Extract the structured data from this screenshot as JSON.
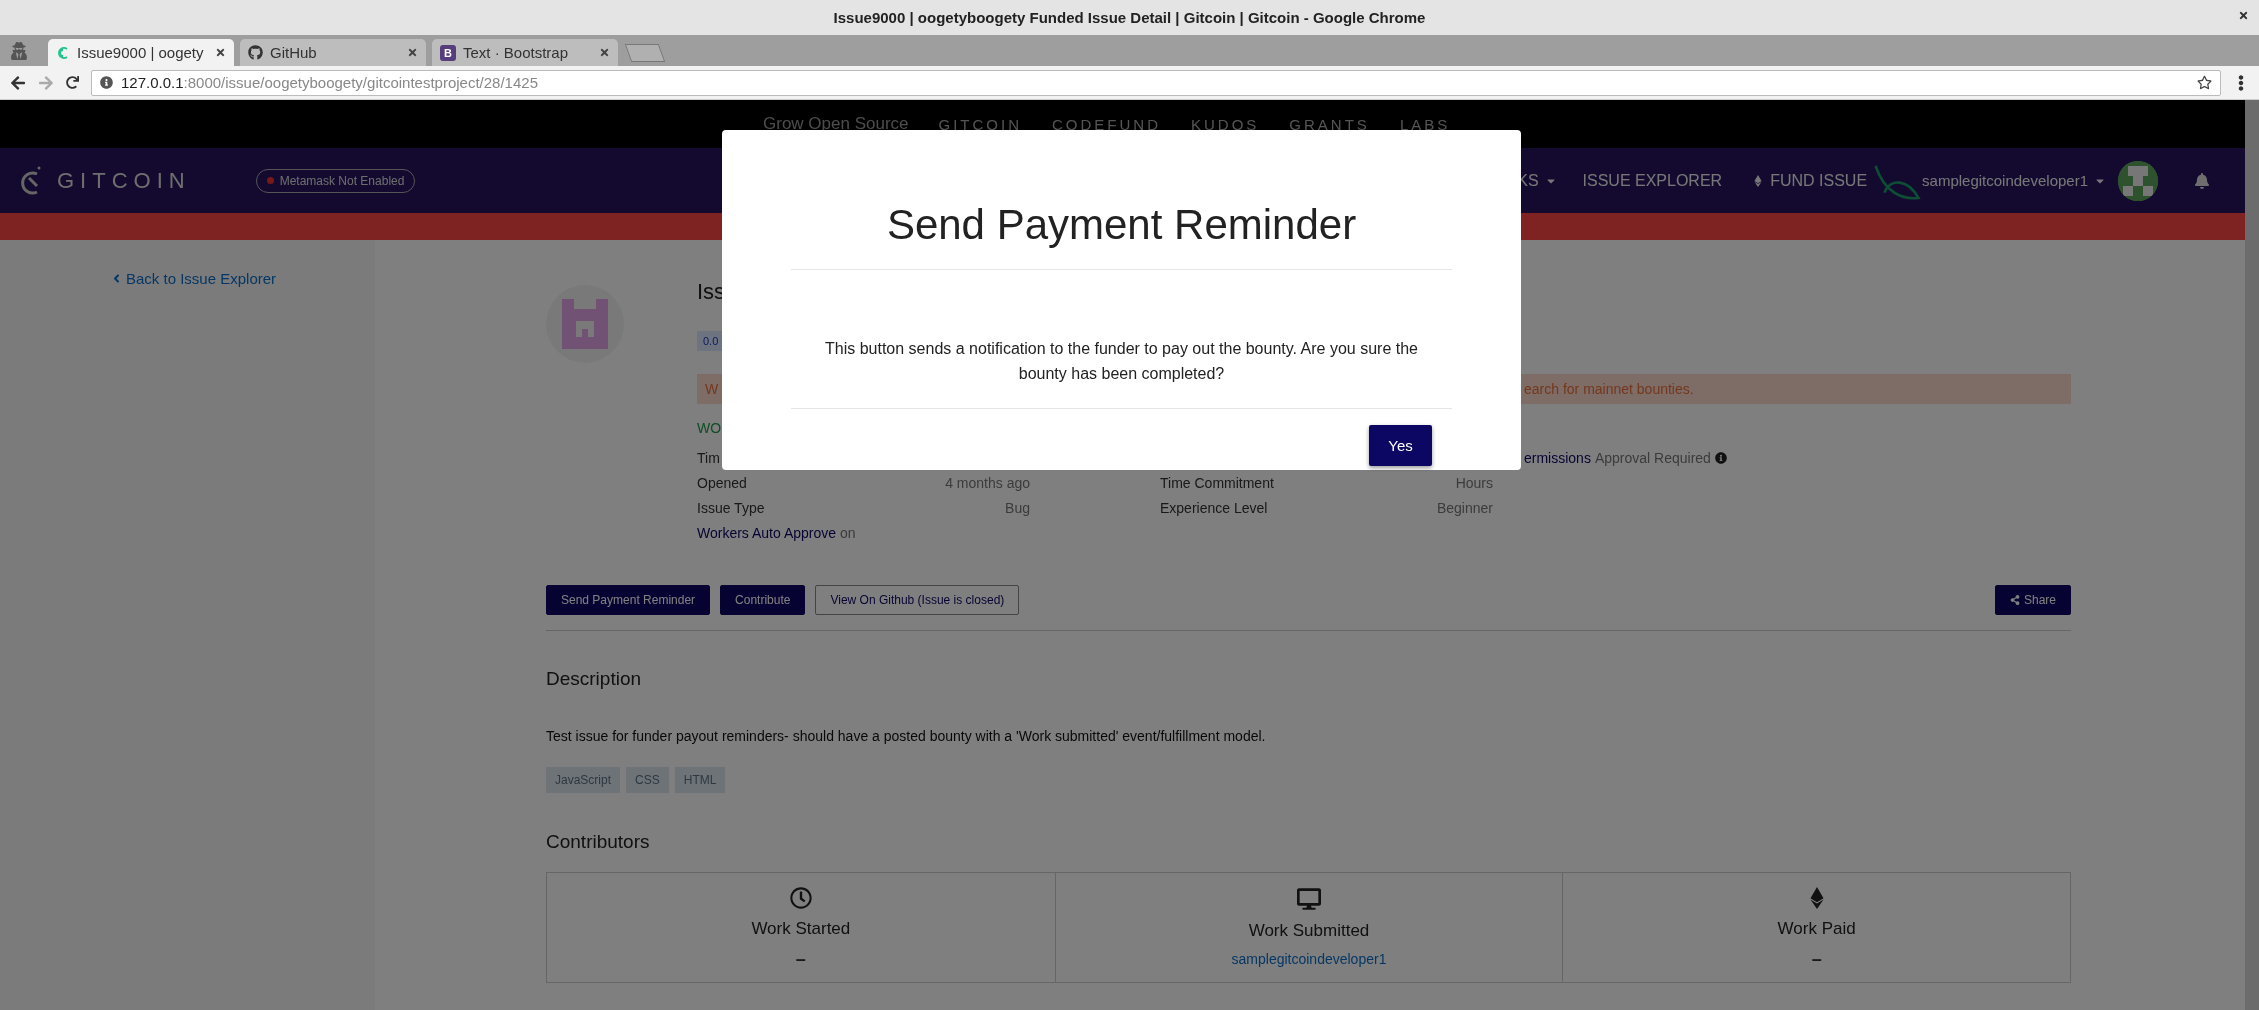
{
  "browser": {
    "window_title": "Issue9000 | oogetyboogety Funded Issue Detail | Gitcoin | Gitcoin - Google Chrome",
    "tabs": [
      {
        "title": "Issue9000 | oogety",
        "selected": true,
        "kind": "swirl"
      },
      {
        "title": "GitHub",
        "selected": false,
        "kind": "cat"
      },
      {
        "title": "Text · Bootstrap",
        "selected": false,
        "kind": "letter",
        "letter": "B"
      }
    ],
    "address": {
      "host": "127.0.0.1",
      "path": ":8000/issue/oogetyboogety/gitcointestproject/28/1425"
    }
  },
  "topbar": {
    "tagline": "Grow Open Source",
    "products": [
      "GITCOIN",
      "CODEFUND",
      "KUDOS",
      "GRANTS",
      "LABS"
    ]
  },
  "navbar": {
    "brand": "GITCOIN",
    "metamask_status": "Metamask Not Enabled",
    "links": [
      {
        "label": "KS",
        "dropdown": true,
        "kind": "plain"
      },
      {
        "label": "ISSUE EXPLORER",
        "dropdown": false,
        "kind": "plain"
      },
      {
        "label": "FUND ISSUE",
        "dropdown": false,
        "kind": "eth"
      }
    ],
    "user": "samplegitcoindeveloper1"
  },
  "sidebar": {
    "back_link": "Back to Issue Explorer"
  },
  "issue": {
    "title": "Iss",
    "badge": "0.0",
    "warning": {
      "start": "W",
      "end": "earch for mainnet bounties."
    },
    "status": "WO",
    "details": [
      {
        "left": {
          "label": "Tim"
        },
        "far": {
          "label": "ermissions",
          "value": "Approval Required",
          "info": true
        }
      },
      {
        "left": {
          "label": "Opened",
          "value": "4 months ago"
        },
        "right": {
          "label": "Time Commitment",
          "value": "Hours"
        }
      },
      {
        "left": {
          "label": "Issue Type",
          "value": "Bug"
        },
        "right": {
          "label": "Experience Level",
          "value": "Beginner"
        }
      }
    ],
    "auto_approve": {
      "label": "Workers Auto Approve",
      "value": "on"
    },
    "actions": [
      {
        "label": "Send Payment Reminder",
        "kind": "primary"
      },
      {
        "label": "Contribute",
        "kind": "primary"
      },
      {
        "label": "View On Github (Issue is closed)",
        "kind": "outline"
      }
    ],
    "share": "Share",
    "description": {
      "heading": "Description",
      "text": "Test issue for funder payout reminders- should have a posted bounty with a 'Work submitted' event/fulfillment model.",
      "tags": [
        "JavaScript",
        "CSS",
        "HTML"
      ]
    },
    "contributors": {
      "heading": "Contributors",
      "stages": [
        {
          "label": "Work Started",
          "value": "–",
          "kind": "started",
          "linked": false
        },
        {
          "label": "Work Submitted",
          "value": "samplegitcoindeveloper1",
          "kind": "submitted",
          "linked": true
        },
        {
          "label": "Work Paid",
          "value": "–",
          "kind": "paid",
          "linked": false
        }
      ]
    }
  },
  "modal": {
    "title": "Send Payment Reminder",
    "message": "This button sends a notification to the funder to pay out the bounty. Are you sure the bounty has been completed?",
    "confirm": "Yes"
  }
}
